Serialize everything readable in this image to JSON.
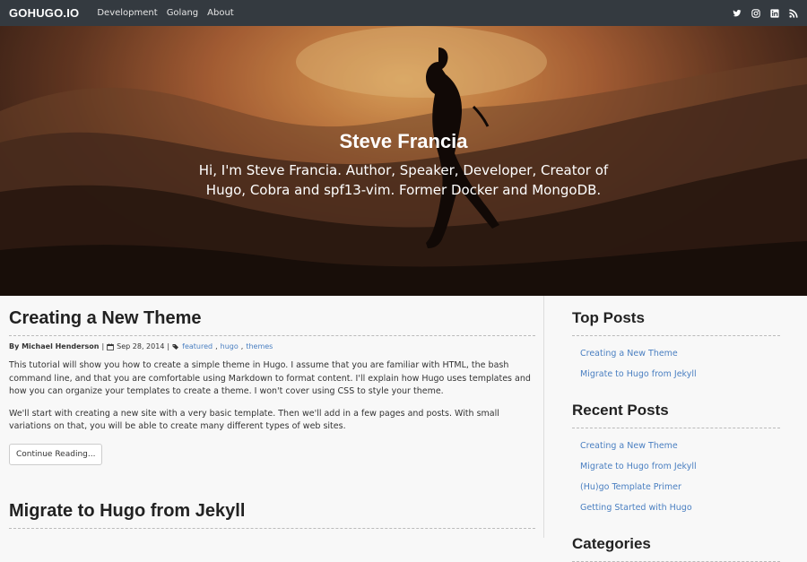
{
  "navbar": {
    "brand": "GOHUGO.IO",
    "links": [
      "Development",
      "Golang",
      "About"
    ],
    "social_icons": [
      "twitter-icon",
      "instagram-icon",
      "linkedin-icon",
      "rss-icon"
    ]
  },
  "hero": {
    "title": "Steve Francia",
    "subtitle": "Hi, I'm Steve Francia. Author, Speaker, Developer, Creator of Hugo, Cobra and spf13-vim. Former Docker and MongoDB."
  },
  "posts": [
    {
      "title": "Creating a New Theme",
      "author": "By Michael Henderson",
      "date": "Sep 28, 2014",
      "tags": [
        "featured",
        "hugo",
        "themes"
      ],
      "paragraphs": [
        "This tutorial will show you how to create a simple theme in Hugo. I assume that you are familiar with HTML, the bash command line, and that you are comfortable using Markdown to format content. I'll explain how Hugo uses templates and how you can organize your templates to create a theme. I won't cover using CSS to style your theme.",
        "We'll start with creating a new site with a very basic template. Then we'll add in a few pages and posts. With small variations on that, you will be able to create many different types of web sites."
      ],
      "button": "Continue Reading..."
    },
    {
      "title": "Migrate to Hugo from Jekyll"
    }
  ],
  "sidebar": {
    "top_posts": {
      "heading": "Top Posts",
      "items": [
        "Creating a New Theme",
        "Migrate to Hugo from Jekyll"
      ]
    },
    "recent_posts": {
      "heading": "Recent Posts",
      "items": [
        "Creating a New Theme",
        "Migrate to Hugo from Jekyll",
        "(Hu)go Template Primer",
        "Getting Started with Hugo"
      ]
    },
    "categories": {
      "heading": "Categories"
    }
  },
  "colors": {
    "navbar_bg": "#343a40",
    "link": "#4a7fc1",
    "page_bg": "#f8f8f8"
  }
}
